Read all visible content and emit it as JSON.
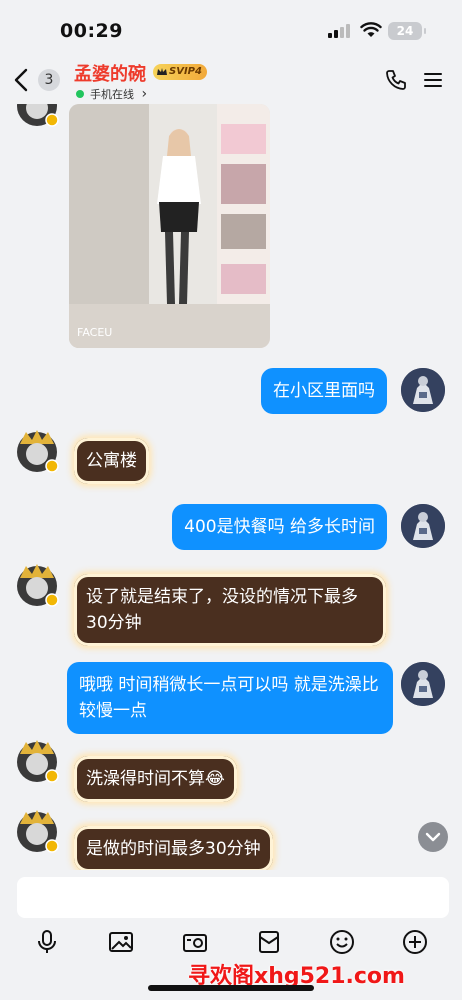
{
  "status_bar": {
    "time": "00:29",
    "battery": "24"
  },
  "header": {
    "unread_count": "3",
    "contact_name": "孟婆的碗",
    "badge": "SVIP4",
    "status": "手机在线",
    "status_chevron": "›"
  },
  "messages": [
    {
      "from": "other",
      "type": "image",
      "watermark": "FACEU"
    },
    {
      "from": "me",
      "text": "在小区里面吗"
    },
    {
      "from": "other",
      "text": "公寓楼"
    },
    {
      "from": "me",
      "text": "400是快餐吗 给多长时间"
    },
    {
      "from": "other",
      "text": "设了就是结束了，没设的情况下最多30分钟"
    },
    {
      "from": "me",
      "text": "哦哦 时间稍微长一点可以吗 就是洗澡比较慢一点"
    },
    {
      "from": "other",
      "text": "洗澡得时间不算😂"
    },
    {
      "from": "other",
      "text": "是做的时间最多30分钟"
    }
  ],
  "input": {
    "placeholder": ""
  },
  "toolbar": [
    "mic-icon",
    "image-icon",
    "camera-icon",
    "red-packet-icon",
    "emoji-icon",
    "plus-icon"
  ],
  "watermark": "寻欢阁xhg521.com",
  "colors": {
    "my_bubble": "#0f91ff",
    "other_bubble": "#4a2f1f",
    "name": "#ee3b2c",
    "online": "#22c55e"
  }
}
